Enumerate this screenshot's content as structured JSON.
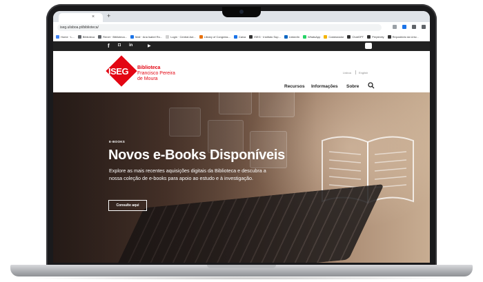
{
  "browser": {
    "new_tab_symbol": "+",
    "tab_close_symbol": "×",
    "url": "iseg.ulisboa.pt/biblioteca/",
    "bookmarks": [
      {
        "label": "Home · L...",
        "color": "#4285f4"
      },
      {
        "label": "Biblioteca",
        "color": "#5f6368"
      },
      {
        "label": "Renet · Biblioteca...",
        "color": "#5f6368"
      },
      {
        "label": "Mail · Ana Isabel Ro...",
        "color": "#1a73e8"
      },
      {
        "label": "Login · Central Aut...",
        "color": "#d0d0d0"
      },
      {
        "label": "Library of Congress...",
        "color": "#e8710a"
      },
      {
        "label": "Caixa",
        "color": "#1a73e8"
      },
      {
        "label": "ISEG · Instituto Sup...",
        "color": "#333333"
      },
      {
        "label": "LinkedIn",
        "color": "#0a66c2"
      },
      {
        "label": "WhatsApp",
        "color": "#25d366"
      },
      {
        "label": "Colaborador",
        "color": "#f4b400"
      },
      {
        "label": "ChatGPT",
        "color": "#333333"
      },
      {
        "label": "Perplexity",
        "color": "#333333"
      },
      {
        "label": "Repositório da Univ...",
        "color": "#333333"
      }
    ]
  },
  "social": {
    "facebook": "f",
    "instagram": "◘",
    "linkedin": "in",
    "youtube": "▶"
  },
  "header": {
    "logo_text": "ISEG",
    "brand_name": "Biblioteca",
    "brand_sub1": "Francisco Pereira",
    "brand_sub2": "de Moura",
    "lang_pt": "Lisboa",
    "lang_en": "English",
    "nav": [
      "Recursos",
      "Informações",
      "Sobre"
    ]
  },
  "hero": {
    "label": "E-BOOKS",
    "title": "Novos e-Books Disponíveis",
    "description": "Explore as mais recentes aquisições digitais da Biblioteca e descubra a nossa coleção de e-books para apoio ao estudo e à investigação.",
    "button": "Consulte aqui"
  },
  "colors": {
    "brand_red": "#e30613",
    "social_bar": "#222222"
  }
}
